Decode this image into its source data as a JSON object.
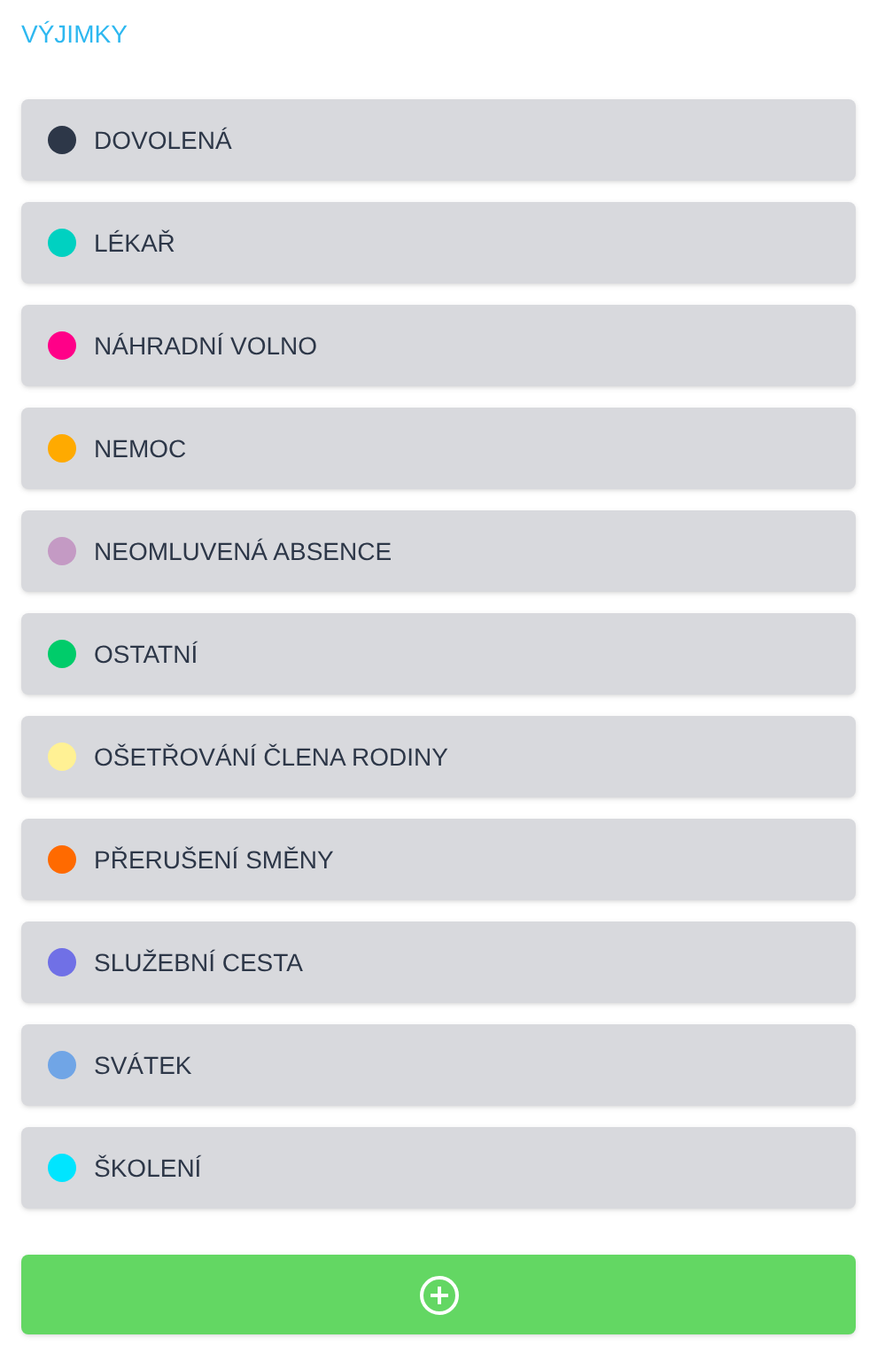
{
  "title": "VÝJIMKY",
  "items": [
    {
      "label": "DOVOLENÁ",
      "color": "#2d3748"
    },
    {
      "label": "LÉKAŘ",
      "color": "#00d1c1"
    },
    {
      "label": "NÁHRADNÍ VOLNO",
      "color": "#ff0088"
    },
    {
      "label": "NEMOC",
      "color": "#ffaa00"
    },
    {
      "label": "NEOMLUVENÁ ABSENCE",
      "color": "#c49ac4"
    },
    {
      "label": "OSTATNÍ",
      "color": "#00cc6a"
    },
    {
      "label": "OŠETŘOVÁNÍ ČLENA RODINY",
      "color": "#fff194"
    },
    {
      "label": "PŘERUŠENÍ SMĚNY",
      "color": "#ff6a00"
    },
    {
      "label": "SLUŽEBNÍ CESTA",
      "color": "#7070e6"
    },
    {
      "label": "SVÁTEK",
      "color": "#70a5e6"
    },
    {
      "label": "ŠKOLENÍ",
      "color": "#00e5ff"
    }
  ]
}
